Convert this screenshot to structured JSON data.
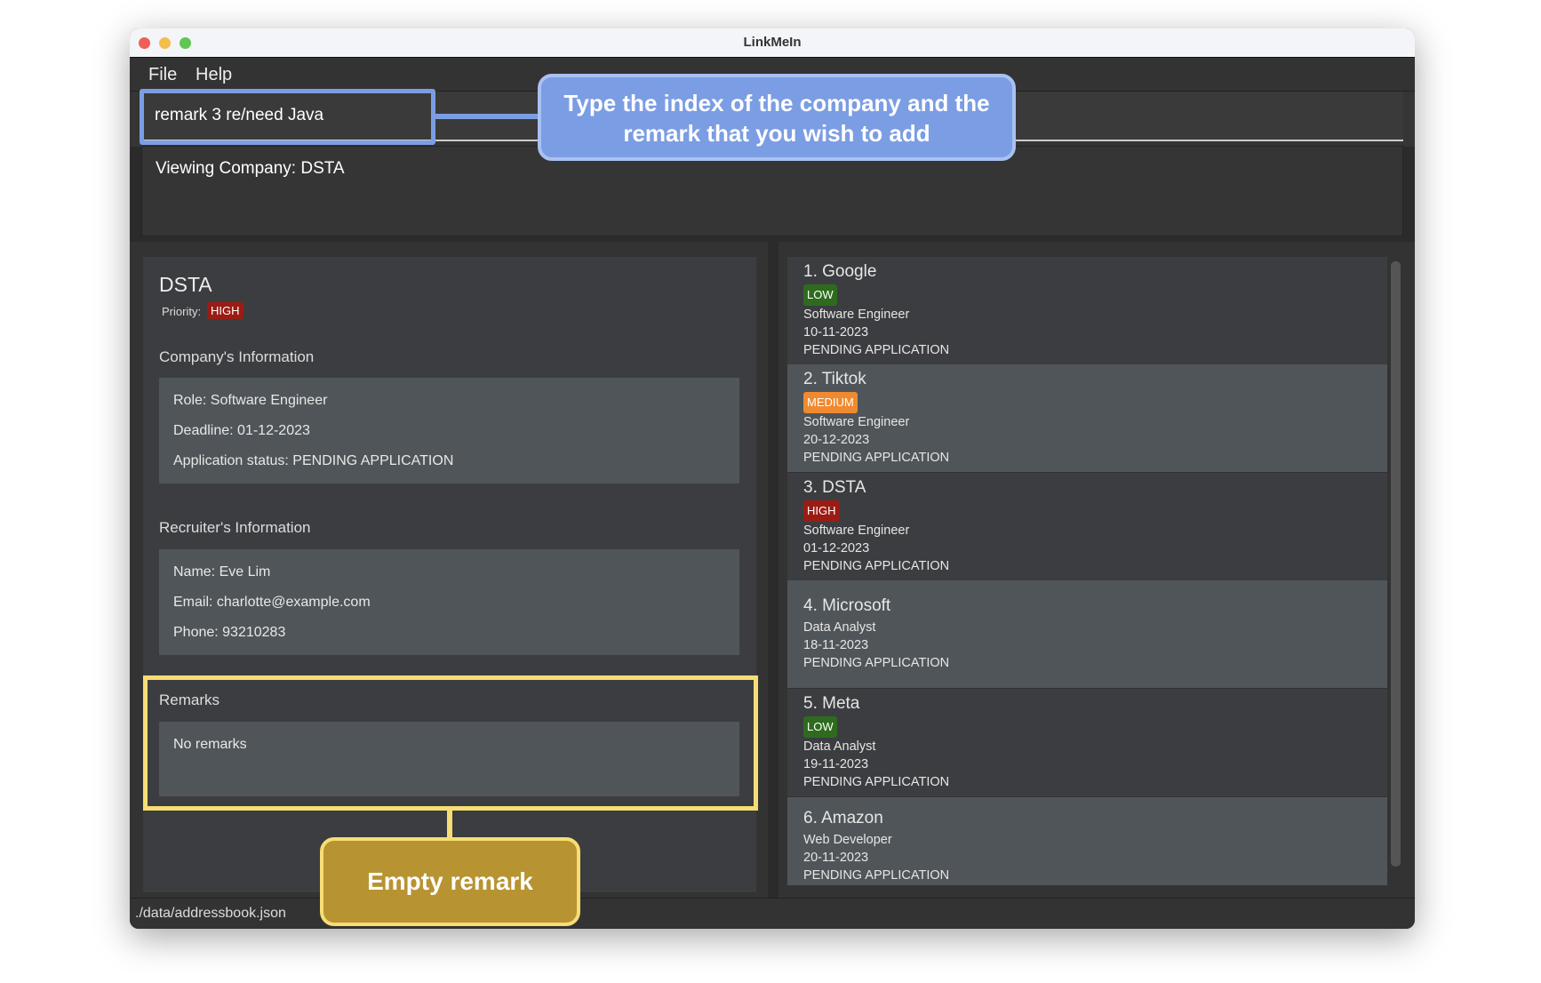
{
  "window": {
    "title": "LinkMeIn"
  },
  "menu": {
    "file": "File",
    "help": "Help"
  },
  "command": {
    "value": "remark 3 re/need Java"
  },
  "result": {
    "text": "Viewing Company: DSTA"
  },
  "detail": {
    "name": "DSTA",
    "priority_label": "Priority:",
    "priority": "HIGH",
    "company_heading": "Company's Information",
    "role": "Role: Software Engineer",
    "deadline": "Deadline: 01-12-2023",
    "status": "Application status: PENDING APPLICATION",
    "recruiter_heading": "Recruiter's Information",
    "recruiter_name": "Name: Eve Lim",
    "email": "Email: charlotte@example.com",
    "phone": "Phone: 93210283",
    "remarks_heading": "Remarks",
    "remarks": "No remarks"
  },
  "companies": [
    {
      "name": "1.  Google",
      "priority": "LOW",
      "role": "Software Engineer",
      "deadline": "10-11-2023",
      "status": "PENDING APPLICATION"
    },
    {
      "name": "2.  Tiktok",
      "priority": "MEDIUM",
      "role": "Software Engineer",
      "deadline": "20-12-2023",
      "status": "PENDING APPLICATION"
    },
    {
      "name": "3.  DSTA",
      "priority": "HIGH",
      "role": "Software Engineer",
      "deadline": "01-12-2023",
      "status": "PENDING APPLICATION"
    },
    {
      "name": "4.  Microsoft",
      "priority": "",
      "role": "Data Analyst",
      "deadline": "18-11-2023",
      "status": "PENDING APPLICATION"
    },
    {
      "name": "5.  Meta",
      "priority": "LOW",
      "role": "Data Analyst",
      "deadline": "19-11-2023",
      "status": "PENDING APPLICATION"
    },
    {
      "name": "6.  Amazon",
      "priority": "",
      "role": "Web Developer",
      "deadline": "20-11-2023",
      "status": "PENDING APPLICATION"
    }
  ],
  "priority_colors": {
    "LOW": "#2e6b1e",
    "MEDIUM": "#f08a30",
    "HIGH": "#9b1c14"
  },
  "status_bar": {
    "path": "./data/addressbook.json"
  },
  "annotations": {
    "command_tip": "Type the index of the company and the remark that you wish to add",
    "remark_tip": "Empty remark"
  }
}
